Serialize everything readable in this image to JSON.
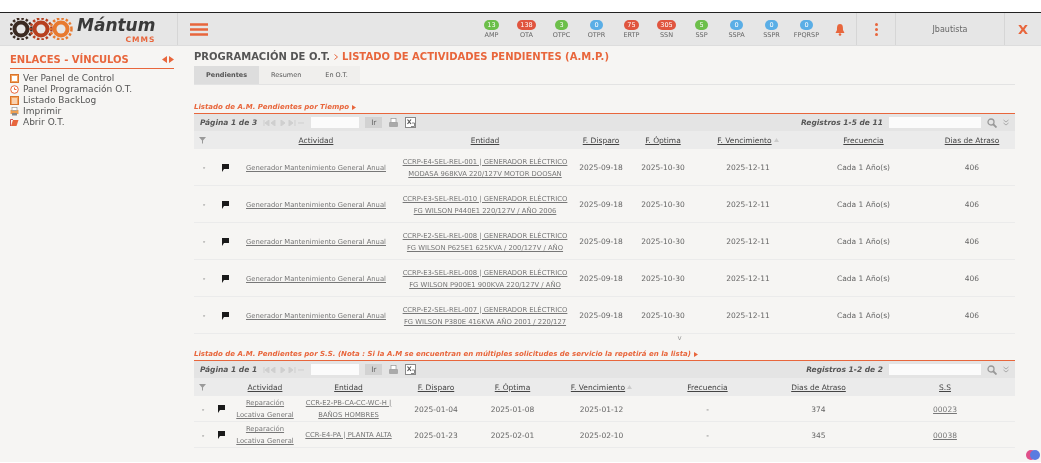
{
  "header": {
    "logo": {
      "name": "Mántum",
      "sub": "CMMS"
    },
    "counters": [
      {
        "label": "AMP",
        "count": "13",
        "color": "#6cbf4a"
      },
      {
        "label": "OTA",
        "count": "138",
        "color": "#e0553f"
      },
      {
        "label": "OTPC",
        "count": "3",
        "color": "#6cbf4a"
      },
      {
        "label": "OTPR",
        "count": "0",
        "color": "#5aaee6"
      },
      {
        "label": "ERTP",
        "count": "75",
        "color": "#e0553f"
      },
      {
        "label": "SSN",
        "count": "305",
        "color": "#e0553f"
      },
      {
        "label": "SSP",
        "count": "5",
        "color": "#6cbf4a"
      },
      {
        "label": "SSPA",
        "count": "0",
        "color": "#5aaee6"
      },
      {
        "label": "SSPR",
        "count": "0",
        "color": "#5aaee6"
      },
      {
        "label": "FPQRSP",
        "count": "0",
        "color": "#5aaee6"
      }
    ],
    "user": "Jbautista",
    "close": "X"
  },
  "sidebar": {
    "title": "ENLACES - VÍNCULOS",
    "items": [
      {
        "label": "Ver Panel de Control",
        "kind": "panel"
      },
      {
        "label": "Panel Programación O.T.",
        "kind": "clock"
      },
      {
        "label": "Listado BackLog",
        "kind": "list"
      },
      {
        "label": "Imprimir",
        "kind": "print"
      },
      {
        "label": "Abrir O.T.",
        "kind": "open"
      }
    ]
  },
  "breadcrumb": [
    "PROGRAMACIÓN DE O.T.",
    "LISTADO DE ACTIVIDADES PENDIENTES (A.M.P.)"
  ],
  "tabs": [
    {
      "label": "Pendientes",
      "selected": true
    },
    {
      "label": "Resumen",
      "selected": false
    },
    {
      "label": "En O.T.",
      "selected": false
    }
  ],
  "sections": [
    {
      "title": "Listado de A.M. Pendientes por Tiempo",
      "page": "Página 1 de 3",
      "go": "Ir",
      "records": "Registros 1-5 de 11",
      "kind": "time",
      "columns": [
        "Actividad",
        "Entidad",
        "F. Disparo",
        "F. Óptima",
        "F. Vencimiento",
        "Frecuencia",
        "Dias de Atraso"
      ],
      "rows": [
        {
          "expander": "-",
          "cells": [
            "Generador Mantenimiento General Anual",
            "CCRP-E4-SEL-REL-001 | GENERADOR ELÉCTRICO MODASA 968KVA 220/127V MOTOR DOOSAN",
            "2025-09-18",
            "2025-10-30",
            "2025-12-11",
            "Cada 1 Año(s)",
            "406"
          ]
        },
        {
          "expander": "-",
          "cells": [
            "Generador Mantenimiento General Anual",
            "CCRP-E3-SEL-REL-010 | GENERADOR ELÉCTRICO FG WILSON P440E1 220/127V / AÑO 2006",
            "2025-09-18",
            "2025-10-30",
            "2025-12-11",
            "Cada 1 Año(s)",
            "406"
          ]
        },
        {
          "expander": "-",
          "cells": [
            "Generador Mantenimiento General Anual",
            "CCRP-E2-SEL-REL-008 | GENERADOR ELÉCTRICO FG WILSON P625E1 625KVA / 200/127V / AÑO",
            "2025-09-18",
            "2025-10-30",
            "2025-12-11",
            "Cada 1 Año(s)",
            "406"
          ]
        },
        {
          "expander": "-",
          "cells": [
            "Generador Mantenimiento General Anual",
            "CCRP-E3-SEL-REL-008 | GENERADOR ELÉCTRICO FG WILSON P900E1 900KVA 220/127V / AÑO",
            "2025-09-18",
            "2025-10-30",
            "2025-12-11",
            "Cada 1 Año(s)",
            "406"
          ]
        },
        {
          "expander": "-",
          "cells": [
            "Generador Mantenimiento General Anual",
            "CCRP-E2-SEL-REL-007 | GENERADOR ELÉCTRICO FG WILSON P380E 416KVA AÑO 2001 / 220/127",
            "2025-09-18",
            "2025-10-30",
            "2025-12-11",
            "Cada 1 Año(s)",
            "406"
          ]
        }
      ],
      "more": "v"
    },
    {
      "title": "Listado de A.M. Pendientes por S.S. (Nota : Si la A.M se encuentran en múltiples solicitudes de servicio la repetirá en la lista)",
      "page": "Página 1 de 1",
      "go": "Ir",
      "records": "Registros 1-2 de 2",
      "kind": "request",
      "columns": [
        "Actividad",
        "Entidad",
        "F. Disparo",
        "F. Óptima",
        "F. Vencimiento",
        "Frecuencia",
        "Dias de Atraso",
        "S.S"
      ],
      "rows": [
        {
          "expander": "-",
          "cells": [
            "Reparación Locativa General",
            "CCR-E2-PB-CA-CC-WC-H | BAÑOS HOMBRES",
            "2025-01-04",
            "2025-01-08",
            "2025-01-12",
            "-",
            "374",
            "00023"
          ]
        },
        {
          "expander": "-",
          "cells": [
            "Reparación Locativa General",
            "CCR-E4-PA | PLANTA ALTA",
            "2025-01-23",
            "2025-02-01",
            "2025-02-10",
            "-",
            "345",
            "00038"
          ]
        }
      ]
    }
  ]
}
